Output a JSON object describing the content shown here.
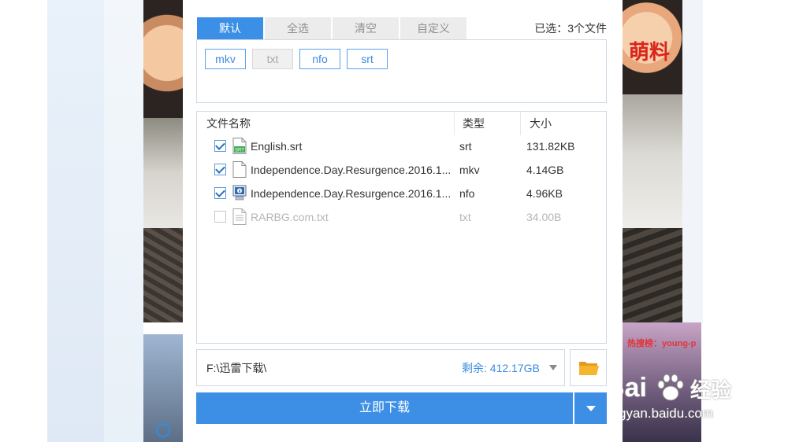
{
  "tabs": [
    {
      "label": "默认",
      "active": true
    },
    {
      "label": "全选",
      "active": false
    },
    {
      "label": "清空",
      "active": false
    },
    {
      "label": "自定义",
      "active": false
    }
  ],
  "selection_status": "已选：3个文件",
  "extension_filters": [
    {
      "label": "mkv",
      "enabled": true
    },
    {
      "label": "txt",
      "enabled": false
    },
    {
      "label": "nfo",
      "enabled": true
    },
    {
      "label": "srt",
      "enabled": true
    }
  ],
  "file_list": {
    "columns": {
      "name": "文件名称",
      "type": "类型",
      "size": "大小"
    },
    "rows": [
      {
        "name": "English.srt",
        "type": "srt",
        "size": "131.82KB",
        "checked": true,
        "icon": "subtitle-file-icon"
      },
      {
        "name": "Independence.Day.Resurgence.2016.1...",
        "type": "mkv",
        "size": "4.14GB",
        "checked": true,
        "icon": "video-file-icon"
      },
      {
        "name": "Independence.Day.Resurgence.2016.1...",
        "type": "nfo",
        "size": "4.96KB",
        "checked": true,
        "icon": "info-file-icon"
      },
      {
        "name": "RARBG.com.txt",
        "type": "txt",
        "size": "34.00B",
        "checked": false,
        "icon": "text-file-icon"
      }
    ]
  },
  "save_path": {
    "path": "F:\\迅雷下载\\",
    "free_space": "剩余: 412.17GB"
  },
  "download_button_label": "立即下载",
  "background": {
    "overlay_text": "萌料",
    "thumb_text": "热搜榜：young-p",
    "watermark_logo": "Bai",
    "watermark_cn": "经验",
    "watermark_url": "jingyan.baidu.com"
  },
  "colors": {
    "accent": "#3c8fe6",
    "tab_inactive": "#ececec",
    "text": "#333333",
    "disabled_text": "#b5b5b5"
  }
}
